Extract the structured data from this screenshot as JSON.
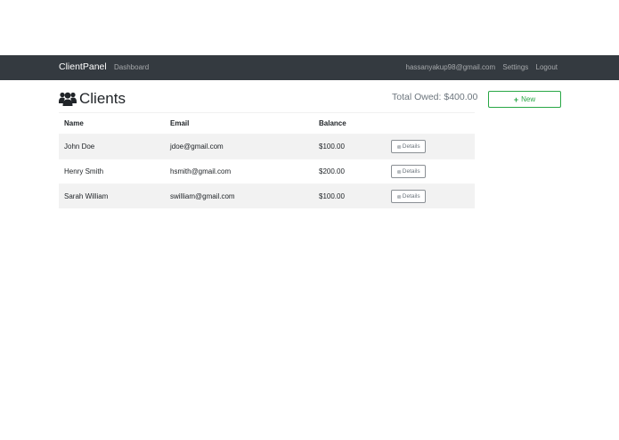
{
  "navbar": {
    "brand": "ClientPanel",
    "dashboard": "Dashboard",
    "user_email": "hassanyakup98@gmail.com",
    "settings": "Settings",
    "logout": "Logout",
    "background_color": "#343a40"
  },
  "page": {
    "title": "Clients",
    "title_icon": "users-icon",
    "total_owed": "Total Owed: $400.00",
    "new_button": "New",
    "new_button_icon": "plus-icon",
    "accent_color": "#28a745"
  },
  "table": {
    "headers": [
      "Name",
      "Email",
      "Balance"
    ],
    "rows": [
      {
        "name": "John Doe",
        "email": "jdoe@gmail.com",
        "balance": "$100.00",
        "action": "Details"
      },
      {
        "name": "Henry Smith",
        "email": "hsmith@gmail.com",
        "balance": "$200.00",
        "action": "Details"
      },
      {
        "name": "Sarah William",
        "email": "swilliam@gmail.com",
        "balance": "$100.00",
        "action": "Details"
      }
    ],
    "action_icon": "arrow-circle-right-icon"
  }
}
